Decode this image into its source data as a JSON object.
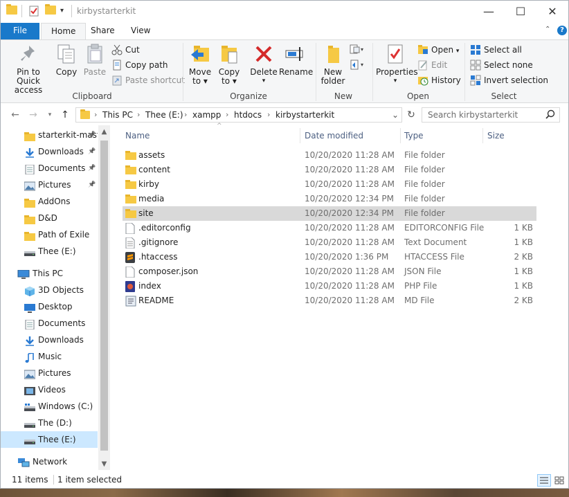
{
  "window": {
    "title": "kirbystarterkit",
    "controls": {
      "minimize": "—",
      "maximize": "☐",
      "close": "✕"
    }
  },
  "ribbon_tabs": {
    "file": "File",
    "home": "Home",
    "share": "Share",
    "view": "View"
  },
  "ribbon": {
    "clipboard": {
      "label": "Clipboard",
      "pin_line1": "Pin to Quick",
      "pin_line2": "access",
      "copy": "Copy",
      "paste": "Paste",
      "cut": "Cut",
      "copy_path": "Copy path",
      "paste_shortcut": "Paste shortcut"
    },
    "organize": {
      "label": "Organize",
      "move_line1": "Move",
      "move_line2": "to",
      "copy_line1": "Copy",
      "copy_line2": "to",
      "delete": "Delete",
      "rename": "Rename"
    },
    "new": {
      "label": "New",
      "new_folder_line1": "New",
      "new_folder_line2": "folder"
    },
    "open": {
      "label": "Open",
      "properties": "Properties",
      "open": "Open",
      "edit": "Edit",
      "history": "History"
    },
    "select": {
      "label": "Select",
      "select_all": "Select all",
      "select_none": "Select none",
      "invert": "Invert selection"
    }
  },
  "address": {
    "crumbs": [
      "This PC",
      "Thee (E:)",
      "xampp",
      "htdocs",
      "kirbystarterkit"
    ],
    "search_placeholder": "Search kirbystarterkit"
  },
  "nav_pane": {
    "quick_access": [
      {
        "label": "starterkit-master",
        "icon": "folder-icon",
        "pinned": true
      },
      {
        "label": "Downloads",
        "icon": "download-icon",
        "pinned": true
      },
      {
        "label": "Documents",
        "icon": "document-icon",
        "pinned": true
      },
      {
        "label": "Pictures",
        "icon": "picture-icon",
        "pinned": true
      },
      {
        "label": "AddOns",
        "icon": "folder-icon",
        "pinned": false
      },
      {
        "label": "D&D",
        "icon": "folder-icon",
        "pinned": false
      },
      {
        "label": "Path of Exile",
        "icon": "folder-icon",
        "pinned": false
      },
      {
        "label": "Thee (E:)",
        "icon": "drive-icon",
        "pinned": false
      }
    ],
    "this_pc": "This PC",
    "this_pc_items": [
      {
        "label": "3D Objects",
        "icon": "cube-icon"
      },
      {
        "label": "Desktop",
        "icon": "desktop-icon"
      },
      {
        "label": "Documents",
        "icon": "document-icon"
      },
      {
        "label": "Downloads",
        "icon": "download-icon"
      },
      {
        "label": "Music",
        "icon": "music-icon"
      },
      {
        "label": "Pictures",
        "icon": "picture-icon"
      },
      {
        "label": "Videos",
        "icon": "video-icon"
      },
      {
        "label": "Windows (C:)",
        "icon": "windows-drive-icon"
      },
      {
        "label": "The (D:)",
        "icon": "drive-icon"
      },
      {
        "label": "Thee (E:)",
        "icon": "drive-icon",
        "selected": true
      }
    ],
    "network": "Network"
  },
  "columns": {
    "name": "Name",
    "date": "Date modified",
    "type": "Type",
    "size": "Size"
  },
  "files": [
    {
      "name": "assets",
      "date": "10/20/2020 11:28 AM",
      "type": "File folder",
      "size": "",
      "icon": "folder-icon"
    },
    {
      "name": "content",
      "date": "10/20/2020 11:28 AM",
      "type": "File folder",
      "size": "",
      "icon": "folder-icon"
    },
    {
      "name": "kirby",
      "date": "10/20/2020 11:28 AM",
      "type": "File folder",
      "size": "",
      "icon": "folder-icon"
    },
    {
      "name": "media",
      "date": "10/20/2020 12:34 PM",
      "type": "File folder",
      "size": "",
      "icon": "folder-icon"
    },
    {
      "name": "site",
      "date": "10/20/2020 12:34 PM",
      "type": "File folder",
      "size": "",
      "icon": "folder-icon",
      "selected": true
    },
    {
      "name": ".editorconfig",
      "date": "10/20/2020 11:28 AM",
      "type": "EDITORCONFIG File",
      "size": "1 KB",
      "icon": "blank-file-icon"
    },
    {
      "name": ".gitignore",
      "date": "10/20/2020 11:28 AM",
      "type": "Text Document",
      "size": "1 KB",
      "icon": "text-file-icon"
    },
    {
      "name": ".htaccess",
      "date": "10/20/2020 1:36 PM",
      "type": "HTACCESS File",
      "size": "2 KB",
      "icon": "sublime-file-icon"
    },
    {
      "name": "composer.json",
      "date": "10/20/2020 11:28 AM",
      "type": "JSON File",
      "size": "1 KB",
      "icon": "blank-file-icon"
    },
    {
      "name": "index",
      "date": "10/20/2020 11:28 AM",
      "type": "PHP File",
      "size": "1 KB",
      "icon": "php-file-icon"
    },
    {
      "name": "README",
      "date": "10/20/2020 11:28 AM",
      "type": "MD File",
      "size": "2 KB",
      "icon": "md-file-icon"
    }
  ],
  "status": {
    "count": "11 items",
    "selection": "1 item selected"
  },
  "colors": {
    "accent": "#1979ca",
    "selection": "#cce8ff",
    "row_selected": "#d9d9d9",
    "folder": "#f6c944"
  }
}
